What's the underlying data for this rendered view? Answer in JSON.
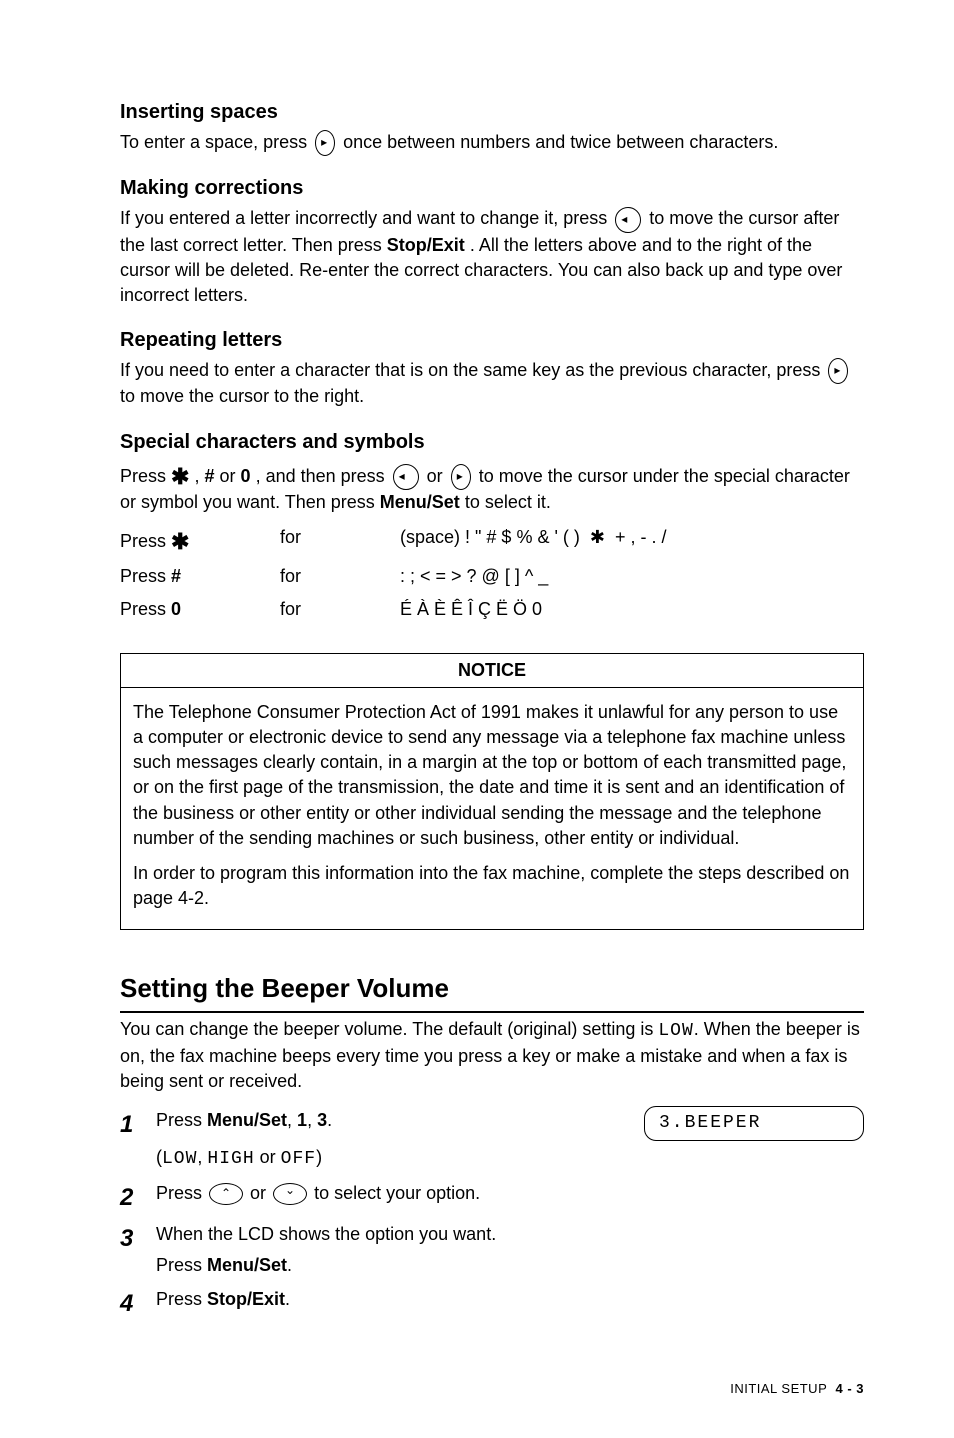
{
  "sections": {
    "inserting_spaces": {
      "title": "Inserting spaces",
      "body_pre": "To enter a space, press ",
      "body_post": " once between numbers and twice between characters."
    },
    "making_corrections": {
      "title": "Making corrections",
      "body_pre": "If you entered a letter incorrectly and want to change it, press ",
      "body_mid": " to move the cursor after the last correct letter. Then press ",
      "stop_exit": "Stop/Exit",
      "body_post": ". All the letters above and to the right of the cursor will be deleted. Re-enter the correct characters. You can also back up and type over incorrect letters."
    },
    "repeating_letters": {
      "title": "Repeating letters",
      "body_pre": "If you need to enter a character that is on the same key as the previous character, press ",
      "body_post": " to move the cursor to the right."
    },
    "special_chars": {
      "title": "Special characters and symbols",
      "line1_a": "Press ",
      "line1_b": " , ",
      "hash": "#",
      "line1_c": " or ",
      "zero": "0",
      "line1_d": ", and then press ",
      "line1_e": " or ",
      "line1_f": " to move the cursor under the special character or symbol you want. Then press ",
      "menu_set": "Menu/Set",
      "line1_g": " to select it."
    },
    "symbol_table": {
      "rows": [
        {
          "col1_a": "Press ",
          "col1_b": "★",
          "col2": "for",
          "col3": "(space) ! \" # $ % & ' ( )  ✱  + , - . /"
        },
        {
          "col1_a": "Press ",
          "col1_b": "#",
          "col2": "for",
          "col3": ": ; < = > ? @ [ ] ^ _"
        },
        {
          "col1_a": "Press ",
          "col1_b": "0",
          "col2": "for",
          "col3": "É À È Ê Î Ç Ë Ö 0"
        }
      ]
    },
    "notice": {
      "title": "NOTICE",
      "para1": "The Telephone Consumer Protection Act of 1991 makes it unlawful for any person to use a computer or electronic device to send any message via a telephone fax machine unless such messages clearly contain, in a margin at the top or bottom of each transmitted page, or on the first page of the transmission, the date and time it is sent and an identification of the business or other entity or other individual sending the message and the telephone number of the sending machines or such business, other entity or individual.",
      "para2": "In order to program this information into the fax machine, complete the steps described on page 4-2."
    },
    "beeper": {
      "title": "Setting the Beeper Volume",
      "intro_a": "You can change the beeper volume. The default (original) setting is ",
      "intro_mono": "LOW",
      "intro_b": ". When the beeper is on, the fax machine beeps every time you press a key or make a mistake and when a fax is being sent or received.",
      "steps": [
        {
          "num": "1",
          "text_a": "Press ",
          "bold": "Menu/Set",
          "text_b": ", ",
          "b1": "1",
          "text_c": ", ",
          "b2": "3",
          "text_d": ".",
          "sub_a": "(",
          "sub_mono1": "LOW",
          "sub_b": ", ",
          "sub_mono2": "HIGH",
          "sub_c": " or ",
          "sub_mono3": "OFF",
          "sub_d": ")",
          "lcd": "3.BEEPER"
        },
        {
          "num": "2",
          "text_a": "Press ",
          "text_b": " or ",
          "text_c": " to select your option."
        },
        {
          "num": "3",
          "text_a": "When the LCD shows the option you want.",
          "text_b": "Press ",
          "bold": "Menu/Set",
          "text_c": "."
        },
        {
          "num": "4",
          "text_a": "Press ",
          "bold": "Stop/Exit",
          "text_b": "."
        }
      ]
    },
    "footer": {
      "label": "INITIAL SETUP",
      "page": "4 - 3"
    }
  }
}
